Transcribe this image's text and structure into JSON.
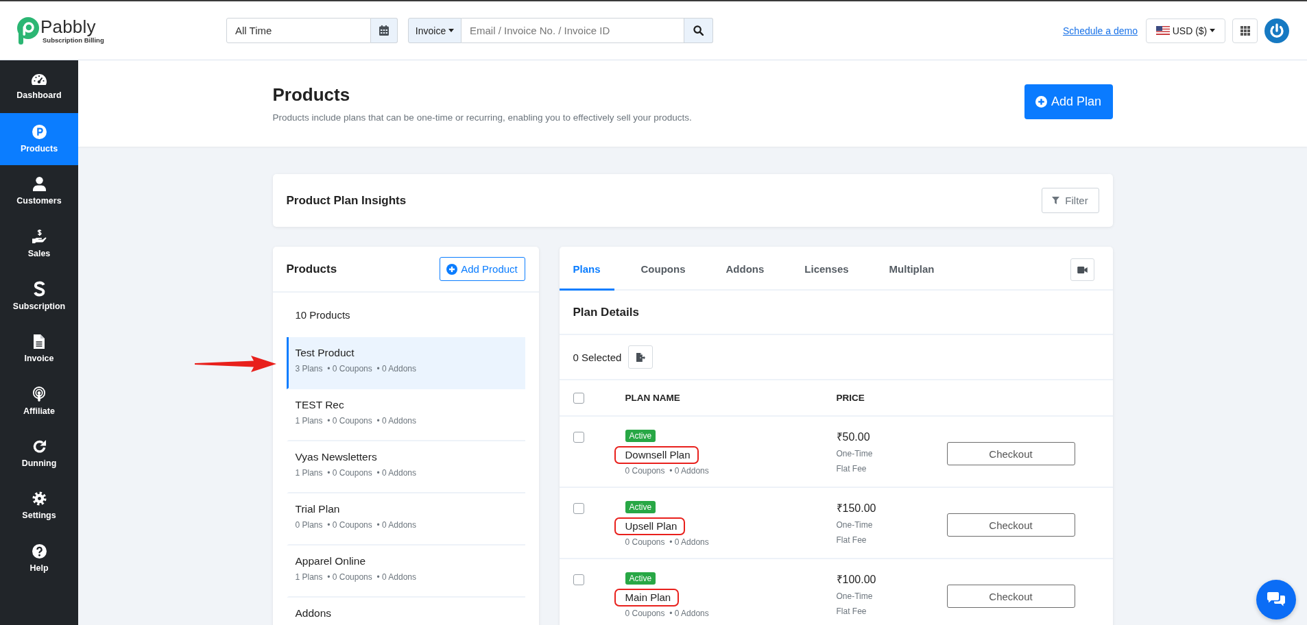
{
  "topbar": {
    "logo": {
      "name": "Pabbly",
      "tagline": "Subscription Billing"
    },
    "date_filter": {
      "value": "All Time"
    },
    "search": {
      "scope": "Invoice",
      "placeholder": "Email / Invoice No. / Invoice ID"
    },
    "demo_link": "Schedule a demo",
    "currency": "USD ($)"
  },
  "sidebar": {
    "items": [
      {
        "label": "Dashboard",
        "selected": false
      },
      {
        "label": "Products",
        "selected": true
      },
      {
        "label": "Customers",
        "selected": false
      },
      {
        "label": "Sales",
        "selected": false
      },
      {
        "label": "Subscription",
        "selected": false
      },
      {
        "label": "Invoice",
        "selected": false
      },
      {
        "label": "Affiliate",
        "selected": false
      },
      {
        "label": "Dunning",
        "selected": false
      },
      {
        "label": "Settings",
        "selected": false
      },
      {
        "label": "Help",
        "selected": false
      }
    ]
  },
  "page": {
    "title": "Products",
    "subtitle": "Products include plans that can be one-time or recurring, enabling you to effectively sell your products.",
    "add_button": "Add Plan"
  },
  "insights": {
    "title": "Product Plan Insights",
    "filter_button": "Filter"
  },
  "products_panel": {
    "title": "Products",
    "add_button": "Add Product",
    "count": "10 Products",
    "items": [
      {
        "name": "Test Product",
        "meta": "3 Plans  • 0 Coupons  • 0 Addons",
        "selected": true,
        "pointed": true
      },
      {
        "name": "TEST Rec",
        "meta": "1 Plans  • 0 Coupons  • 0 Addons",
        "selected": false,
        "pointed": false
      },
      {
        "name": "Vyas Newsletters",
        "meta": "1 Plans  • 0 Coupons  • 0 Addons",
        "selected": false,
        "pointed": false
      },
      {
        "name": "Trial Plan",
        "meta": "0 Plans  • 0 Coupons  • 0 Addons",
        "selected": false,
        "pointed": false
      },
      {
        "name": "Apparel Online",
        "meta": "1 Plans  • 0 Coupons  • 0 Addons",
        "selected": false,
        "pointed": false
      },
      {
        "name": "Addons",
        "selected": false,
        "pointed": false
      }
    ]
  },
  "plans_panel": {
    "tabs": [
      {
        "label": "Plans",
        "selected": true
      },
      {
        "label": "Coupons",
        "selected": false
      },
      {
        "label": "Addons",
        "selected": false
      },
      {
        "label": "Licenses",
        "selected": false
      },
      {
        "label": "Multiplan",
        "selected": false
      }
    ],
    "section_title": "Plan Details",
    "selected_count": "0 Selected",
    "select_all": {
      "checked": false
    },
    "columns": [
      "PLAN NAME",
      "PRICE"
    ],
    "rows": [
      {
        "checked": false,
        "status": "Active",
        "name": "Downsell Plan",
        "circled": true,
        "meta": "0 Coupons  • 0 Addons",
        "price": "₹50.00",
        "billing": "One-Time",
        "fee": "Flat Fee",
        "action": "Checkout"
      },
      {
        "checked": false,
        "status": "Active",
        "name": "Upsell Plan",
        "circled": true,
        "meta": "0 Coupons  • 0 Addons",
        "price": "₹150.00",
        "billing": "One-Time",
        "fee": "Flat Fee",
        "action": "Checkout"
      },
      {
        "checked": false,
        "status": "Active",
        "name": "Main Plan",
        "circled": true,
        "meta": "0 Coupons  • 0 Addons",
        "price": "₹100.00",
        "billing": "One-Time",
        "fee": "Flat Fee",
        "action": "Checkout"
      }
    ]
  }
}
